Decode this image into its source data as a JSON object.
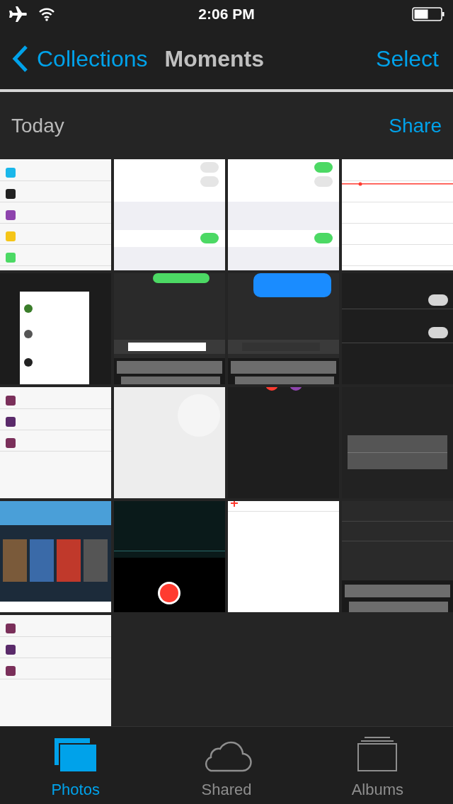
{
  "status_bar": {
    "time": "2:06 PM"
  },
  "nav": {
    "back": "Collections",
    "title": "Moments",
    "action": "Select"
  },
  "section": {
    "title": "Today",
    "action": "Share"
  },
  "tabs": [
    {
      "label": "Photos",
      "kind": "photos",
      "selected": true
    },
    {
      "label": "Shared",
      "kind": "shared",
      "selected": false
    },
    {
      "label": "Albums",
      "kind": "albums",
      "selected": false
    }
  ]
}
